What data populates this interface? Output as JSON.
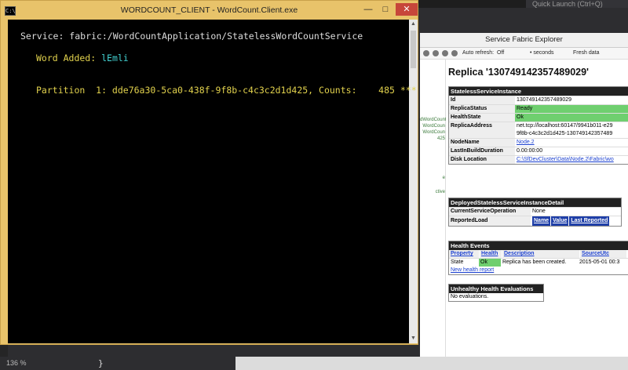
{
  "ide": {
    "quick_launch": "Quick Launch (Ctrl+Q)",
    "zoom": "136 %",
    "brace": "}"
  },
  "console": {
    "title": "WORDCOUNT_CLIENT - WordCount.Client.exe",
    "icon_text": "C:\\",
    "controls": {
      "minimize": "—",
      "maximize": "□",
      "close": "✕"
    },
    "line_service": "Service: fabric:/WordCountApplication/StatelessWordCountService",
    "word_added_label": "Word Added: ",
    "word_added_value": "lEmli",
    "partition_line": "Partition  1: dde76a30-5ca0-438f-9f8b-c4c3c2d1d425, Counts:    485 ***",
    "colors": {
      "background": "#000000",
      "yellow": "#e2d24d",
      "cyan": "#42d0d0",
      "frame": "#e8c36a"
    }
  },
  "sfx": {
    "window_title": "Service Fabric Explorer",
    "toolbar": {
      "auto_refresh_label": "Auto refresh:",
      "auto_refresh_value": "Off",
      "seconds_label": "• seconds",
      "fresh_data": "Fresh data"
    },
    "left_fragments": [
      "dWordCounter",
      "WordCoun",
      "WordCoun",
      "425",
      "e",
      "ctive"
    ],
    "replica_title": "Replica '130749142357489029'",
    "instance_panel": {
      "title": "StatelessServiceInstance",
      "rows": [
        {
          "k": "Id",
          "v": "130749142357489029"
        },
        {
          "k": "ReplicaStatus",
          "v": "Ready"
        },
        {
          "k": "HealthState",
          "v": "Ok"
        },
        {
          "k": "ReplicaAddress",
          "v": "net.tcp://localhost:60147/9941b011-e29",
          "v2": "9f8b-c4c3c2d1d425-130749142357489"
        },
        {
          "k": "NodeName",
          "v": "Node.2"
        },
        {
          "k": "LastInBuildDuration",
          "v": "0.00:00:00"
        },
        {
          "k": "Disk Location",
          "v": "C:\\SfDevCluster\\Data\\Node.2\\Fabric\\wo"
        }
      ]
    },
    "deployed_panel": {
      "title": "DeployedStatelessServiceInstanceDetail",
      "current_op_label": "CurrentServiceOperation",
      "current_op_value": "None",
      "reported_load_label": "ReportedLoad",
      "load_headers": [
        "Name",
        "Value",
        "Last Reported"
      ]
    },
    "health_events": {
      "title": "Health Events",
      "headers": [
        "Property",
        "Health",
        "Description",
        "SourceUtc"
      ],
      "row": {
        "property": "State",
        "health": "Ok",
        "description": "Replica has been created.",
        "source": "2015-05-01 00:3"
      },
      "new_report": "New health report"
    },
    "unhealthy": {
      "title": "Unhealthy Health Evaluations",
      "value": "No evaluations."
    },
    "colors": {
      "ok_green": "#6fcf6f",
      "link": "#1a3fd0",
      "panel_header": "#222222"
    }
  }
}
